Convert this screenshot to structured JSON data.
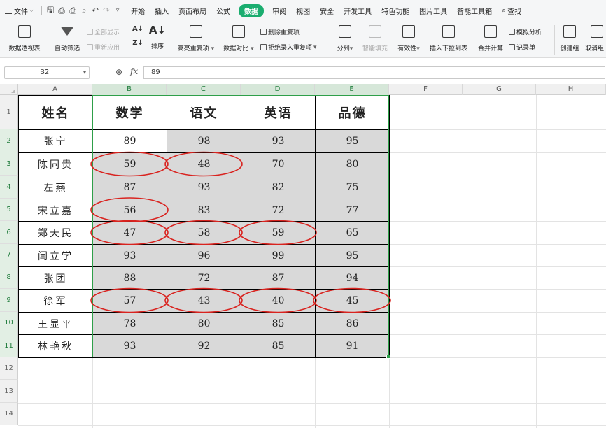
{
  "menubar": {
    "file_label": "文件",
    "tabs": [
      "开始",
      "插入",
      "页面布局",
      "公式",
      "数据",
      "审阅",
      "视图",
      "安全",
      "开发工具",
      "特色功能",
      "图片工具",
      "智能工具箱"
    ],
    "active_tab": "数据",
    "search_label": "查找"
  },
  "ribbon": {
    "pivot_table": "数据透视表",
    "auto_filter": "自动筛选",
    "show_all": "全部显示",
    "reapply": "重新应用",
    "sort": "排序",
    "highlight_dup": "高亮重复项",
    "compare": "数据对比",
    "remove_dup": "删除重复项",
    "reject_dup": "拒绝录入重复项",
    "split_col": "分列",
    "smart_fill": "智能填充",
    "validity": "有效性",
    "insert_dropdown": "插入下拉列表",
    "consolidate": "合并计算",
    "what_if": "模拟分析",
    "record_sheet": "记录单",
    "create_group": "创建组",
    "ungroup": "取消组"
  },
  "formula_bar": {
    "name_box": "B2",
    "fx": "fx",
    "value": "89"
  },
  "columns": [
    "A",
    "B",
    "C",
    "D",
    "E",
    "F",
    "G",
    "H"
  ],
  "selected_columns": [
    "B",
    "C",
    "D",
    "E"
  ],
  "rows": [
    "1",
    "2",
    "3",
    "4",
    "5",
    "6",
    "7",
    "8",
    "9",
    "10",
    "11",
    "12",
    "13",
    "14"
  ],
  "selected_rows": [
    "2",
    "3",
    "4",
    "5",
    "6",
    "7",
    "8",
    "9",
    "10",
    "11"
  ],
  "table": {
    "headers": [
      "姓名",
      "数学",
      "语文",
      "英语",
      "品德"
    ],
    "records": [
      {
        "name": "张宁",
        "scores": [
          "89",
          "98",
          "93",
          "95"
        ]
      },
      {
        "name": "陈同贵",
        "scores": [
          "59",
          "48",
          "70",
          "80"
        ]
      },
      {
        "name": "左燕",
        "scores": [
          "87",
          "93",
          "82",
          "75"
        ]
      },
      {
        "name": "宋立嘉",
        "scores": [
          "56",
          "83",
          "72",
          "77"
        ]
      },
      {
        "name": "郑天民",
        "scores": [
          "47",
          "58",
          "59",
          "65"
        ]
      },
      {
        "name": "闫立学",
        "scores": [
          "93",
          "96",
          "99",
          "95"
        ]
      },
      {
        "name": "张团",
        "scores": [
          "88",
          "72",
          "87",
          "94"
        ]
      },
      {
        "name": "徐军",
        "scores": [
          "57",
          "43",
          "40",
          "45"
        ]
      },
      {
        "name": "王显平",
        "scores": [
          "78",
          "80",
          "85",
          "86"
        ]
      },
      {
        "name": "林艳秋",
        "scores": [
          "93",
          "92",
          "85",
          "91"
        ]
      }
    ]
  },
  "circled_cells": [
    [
      1,
      0
    ],
    [
      1,
      1
    ],
    [
      3,
      0
    ],
    [
      4,
      0
    ],
    [
      4,
      1
    ],
    [
      4,
      2
    ],
    [
      7,
      0
    ],
    [
      7,
      1
    ],
    [
      7,
      2
    ],
    [
      7,
      3
    ]
  ],
  "colors": {
    "accent": "#1aad6f",
    "selection": "#2e9f49",
    "circle": "#d9231f",
    "shade": "#d9d9d9"
  }
}
